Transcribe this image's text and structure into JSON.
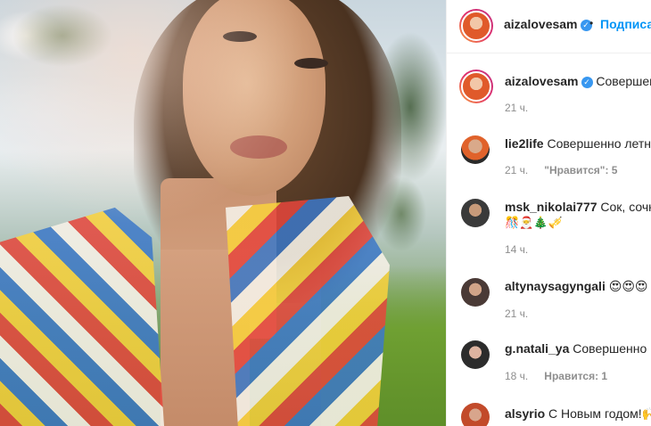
{
  "post_author": {
    "username": "aizalovesam",
    "verified": true,
    "follow_label": "Подписат"
  },
  "caption": {
    "username": "aizalovesam",
    "text": "Совершенно",
    "time": "21 ч."
  },
  "comments": [
    {
      "username": "lie2life",
      "text": "Совершенно летня",
      "time": "21 ч.",
      "likes": "\"Нравится\": 5"
    },
    {
      "username": "msk_nikolai777",
      "text": "Сок, сочно",
      "emoji_line": "🎊🎅🎄🎺",
      "time": "14 ч."
    },
    {
      "username": "altynaysagyngali",
      "text": "😍😍😍",
      "time": "21 ч."
    },
    {
      "username": "g.natali_ya",
      "text": "Совершенно кр",
      "time": "18 ч.",
      "likes": "Нравится: 1"
    },
    {
      "username": "alsyrio",
      "text": "С Новым годом!🙌"
    }
  ],
  "colors": {
    "accent": "#0095f6",
    "verified": "#3897f0",
    "muted": "#8e8e8e"
  }
}
